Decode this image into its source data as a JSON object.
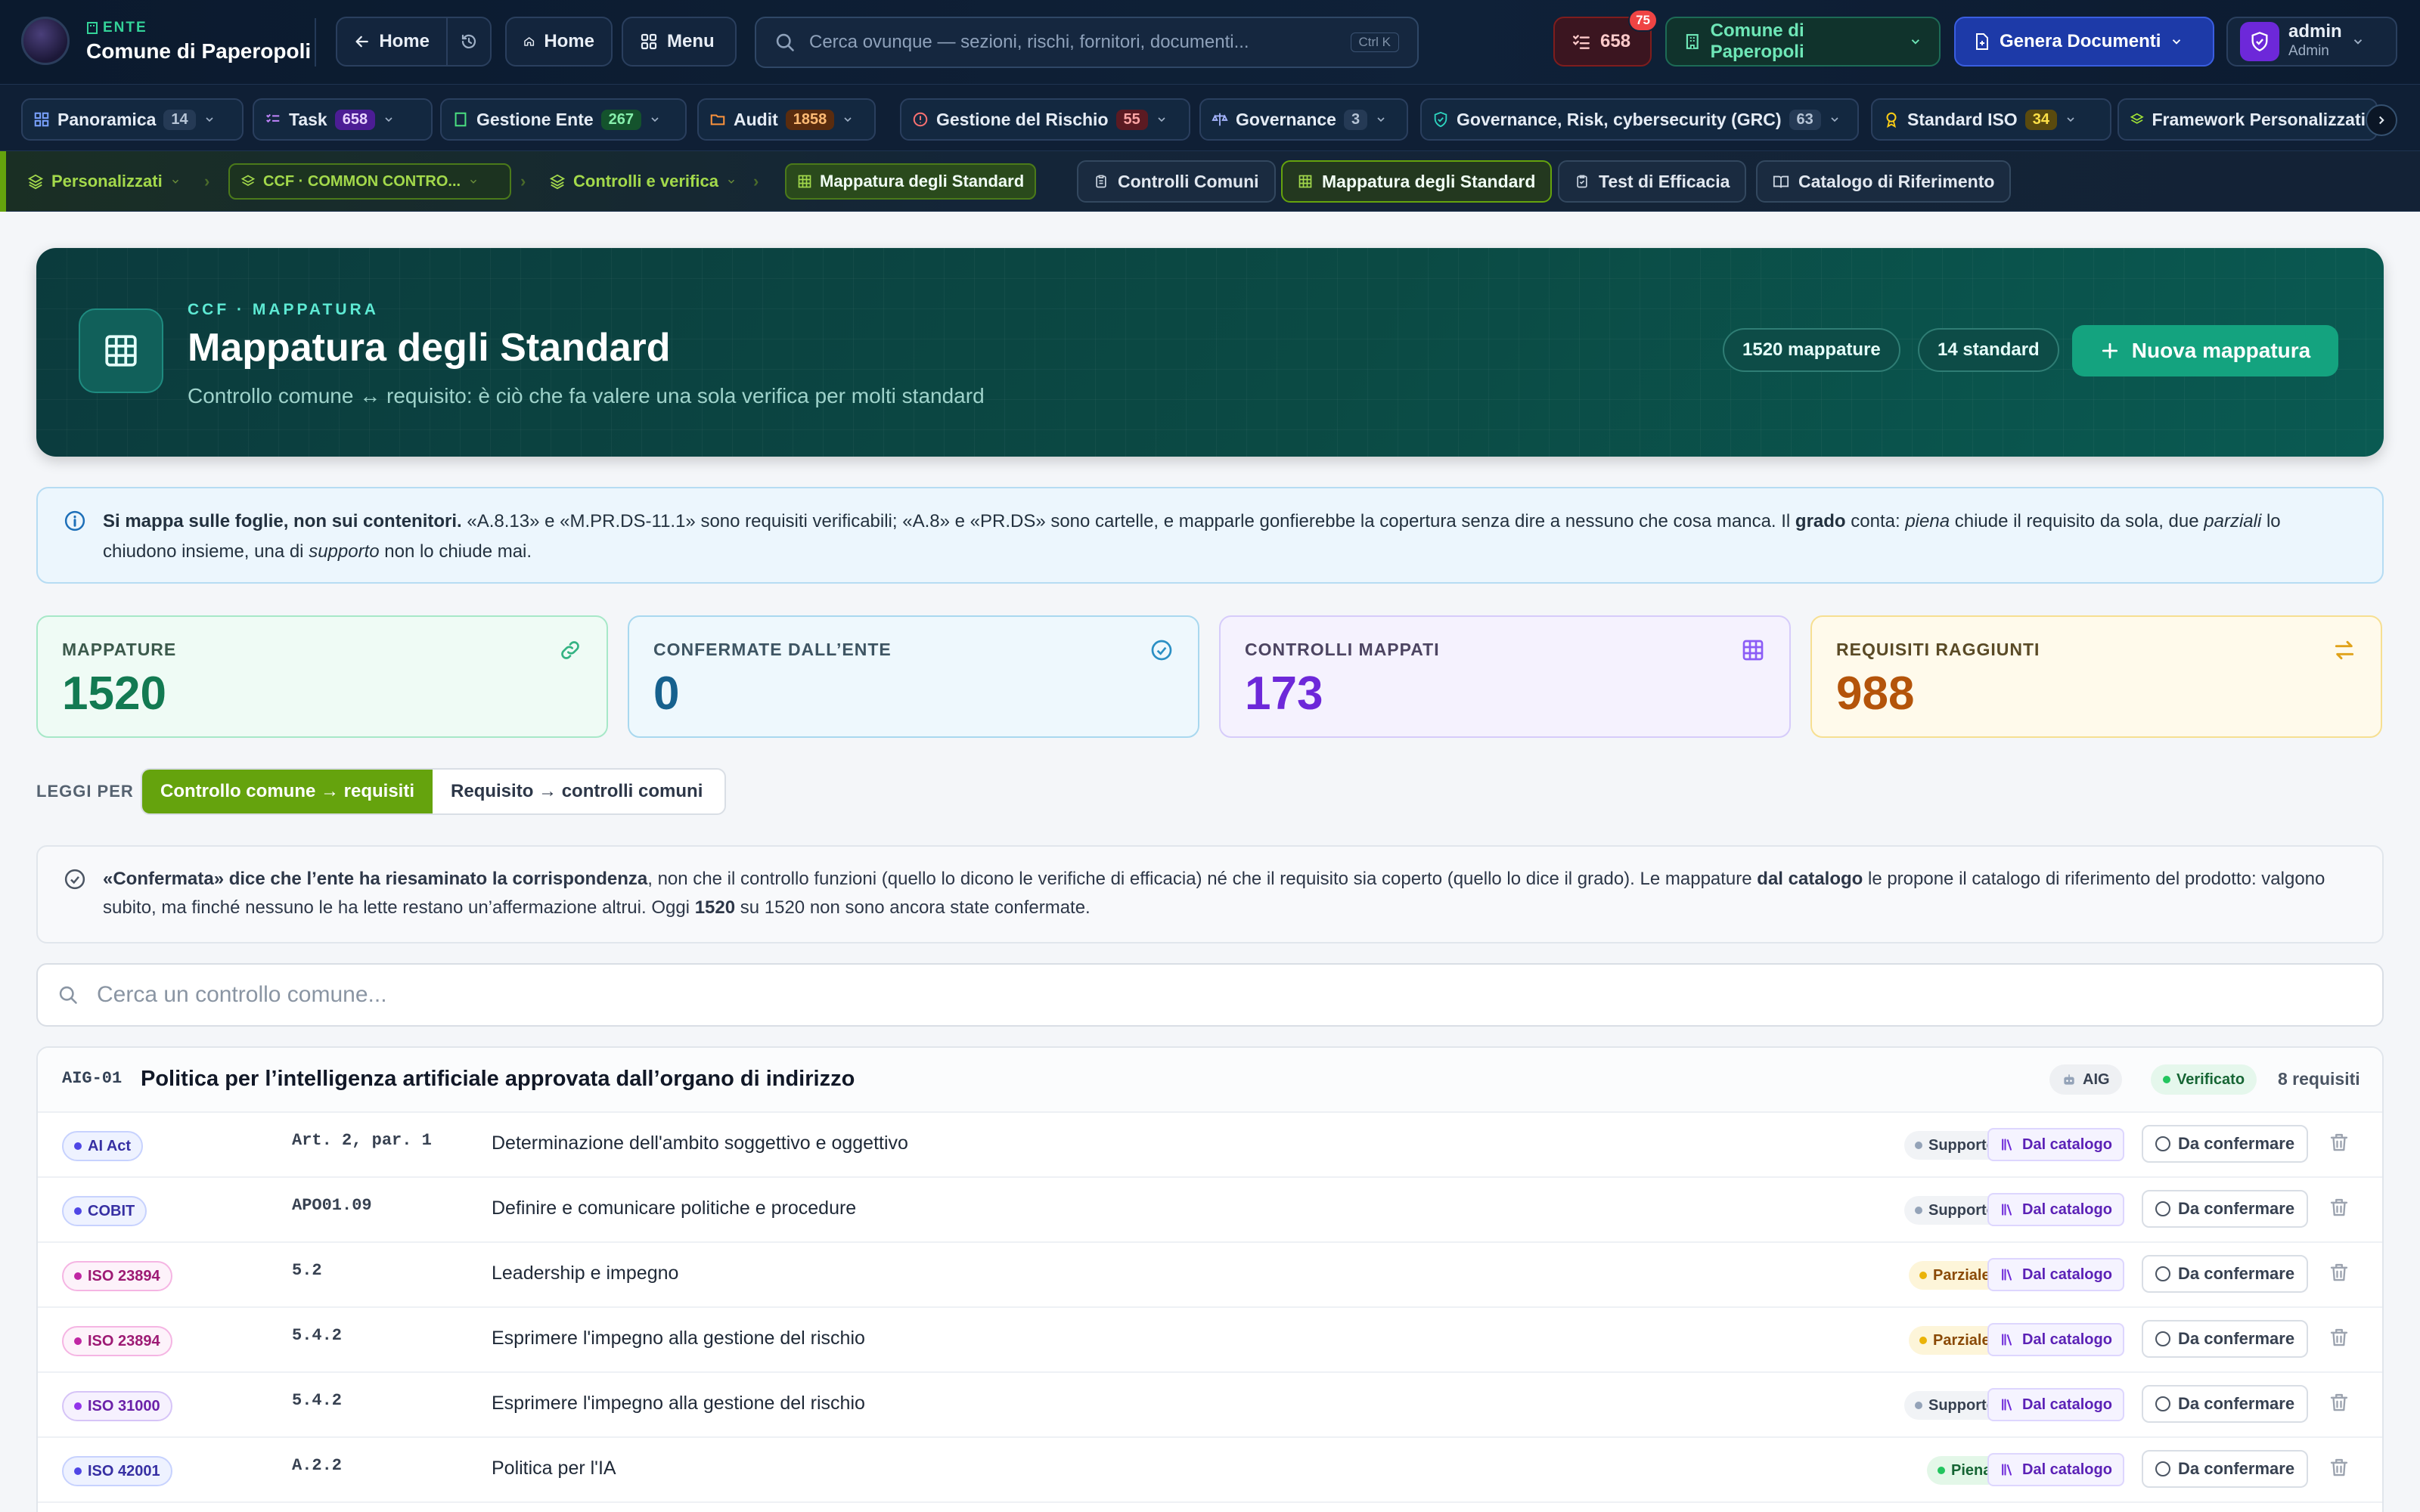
{
  "topbar": {
    "ente_label": "ENTE",
    "ente_name": "Comune di Paperopoli",
    "back_home": "Home",
    "home": "Home",
    "menu": "Menu",
    "search_placeholder": "Cerca ovunque — sezioni, rischi, fornitori, documenti...",
    "search_shortcut": "Ctrl K",
    "tasks_count": "658",
    "tasks_badge": "75",
    "ente_select": "Comune di Paperopoli",
    "genera": "Genera Documenti",
    "user_name": "admin",
    "user_role": "Admin"
  },
  "modules": [
    {
      "label": "Panoramica",
      "count": "14"
    },
    {
      "label": "Task",
      "count": "658"
    },
    {
      "label": "Gestione Ente",
      "count": "267"
    },
    {
      "label": "Audit",
      "count": "1858"
    },
    {
      "label": "Gestione del Rischio",
      "count": "55"
    },
    {
      "label": "Governance",
      "count": "3"
    },
    {
      "label": "Governance, Risk, cybersecurity (GRC)",
      "count": "63"
    },
    {
      "label": "Standard ISO",
      "count": "34"
    },
    {
      "label": "Framework Personalizzati",
      "count": ""
    }
  ],
  "breadcrumb": {
    "c1": "Personalizzati",
    "c2": "CCF · COMMON CONTRO...",
    "c3": "Controlli e verifica",
    "c4": "Mappatura degli Standard"
  },
  "tabs": [
    "Controlli Comuni",
    "Mappatura degli Standard",
    "Test di Efficacia",
    "Catalogo di Riferimento"
  ],
  "hero": {
    "eyebrow": "CCF · MAPPATURA",
    "title": "Mappatura degli Standard",
    "subtitle": "Controllo comune ↔ requisito: è ciò che fa valere una sola verifica per molti standard",
    "pill_mappature": "1520 mappature",
    "pill_standard": "14 standard",
    "new_button": "Nuova mappatura"
  },
  "info": {
    "b1": "Si mappa sulle foglie, non sui contenitori.",
    "t1": " «A.8.13» e «M.PR.DS-11.1» sono requisiti verificabili; «A.8» e «PR.DS» sono cartelle, e mapparle gonfierebbe la copertura senza dire a nessuno che cosa manca. Il ",
    "b2": "grado",
    "t2": " conta: ",
    "i1": "piena",
    "t3": " chiude il requisito da sola, due ",
    "i2": "parziali",
    "t4": " lo chiudono insieme, una di ",
    "i3": "supporto",
    "t5": " non lo chiude mai."
  },
  "stats": [
    {
      "label": "MAPPATURE",
      "value": "1520"
    },
    {
      "label": "CONFERMATE DALL’ENTE",
      "value": "0"
    },
    {
      "label": "CONTROLLI MAPPATI",
      "value": "173"
    },
    {
      "label": "REQUISITI RAGGIUNTI",
      "value": "988"
    }
  ],
  "view": {
    "label": "LEGGI PER",
    "opt1": "Controllo comune → requisiti",
    "opt2": "Requisito → controlli comuni"
  },
  "note": {
    "b1": "«Confermata» dice che l’ente ha riesaminato la corrispondenza",
    "t1": ", non che il controllo funzioni (quello lo dicono le verifiche di efficacia) né che il requisito sia coperto (quello lo dice il grado). Le mappature ",
    "b2": "dal catalogo",
    "t2": " le propone il catalogo di riferimento del prodotto: valgono subito, ma finché nessuno le ha lette restano un’affermazione altrui. Oggi ",
    "b3": "1520",
    "t3": " su 1520 non sono ancora state confermate."
  },
  "list_search_placeholder": "Cerca un controllo comune...",
  "control": {
    "code": "AIG-01",
    "title": "Politica per l’intelligenza artificiale approvata dall’organo di indirizzo",
    "tag": "AIG",
    "status": "Verificato",
    "count": "8 requisiti"
  },
  "rows": [
    {
      "std": "AI Act",
      "req": "Art. 2, par. 1",
      "title": "Determinazione dell'ambito soggettivo e oggettivo",
      "grade": "Supporto",
      "source": "Dal catalogo",
      "state": "Da confermare"
    },
    {
      "std": "COBIT",
      "req": "APO01.09",
      "title": "Definire e comunicare politiche e procedure",
      "grade": "Supporto",
      "source": "Dal catalogo",
      "state": "Da confermare"
    },
    {
      "std": "ISO 23894",
      "req": "5.2",
      "title": "Leadership e impegno",
      "grade": "Parziale",
      "source": "Dal catalogo",
      "state": "Da confermare"
    },
    {
      "std": "ISO 23894",
      "req": "5.4.2",
      "title": "Esprimere l'impegno alla gestione del rischio",
      "grade": "Parziale",
      "source": "Dal catalogo",
      "state": "Da confermare"
    },
    {
      "std": "ISO 31000",
      "req": "5.4.2",
      "title": "Esprimere l'impegno alla gestione del rischio",
      "grade": "Supporto",
      "source": "Dal catalogo",
      "state": "Da confermare"
    },
    {
      "std": "ISO 42001",
      "req": "A.2.2",
      "title": "Politica per l'IA",
      "grade": "Piena",
      "source": "Dal catalogo",
      "state": "Da confermare"
    }
  ]
}
